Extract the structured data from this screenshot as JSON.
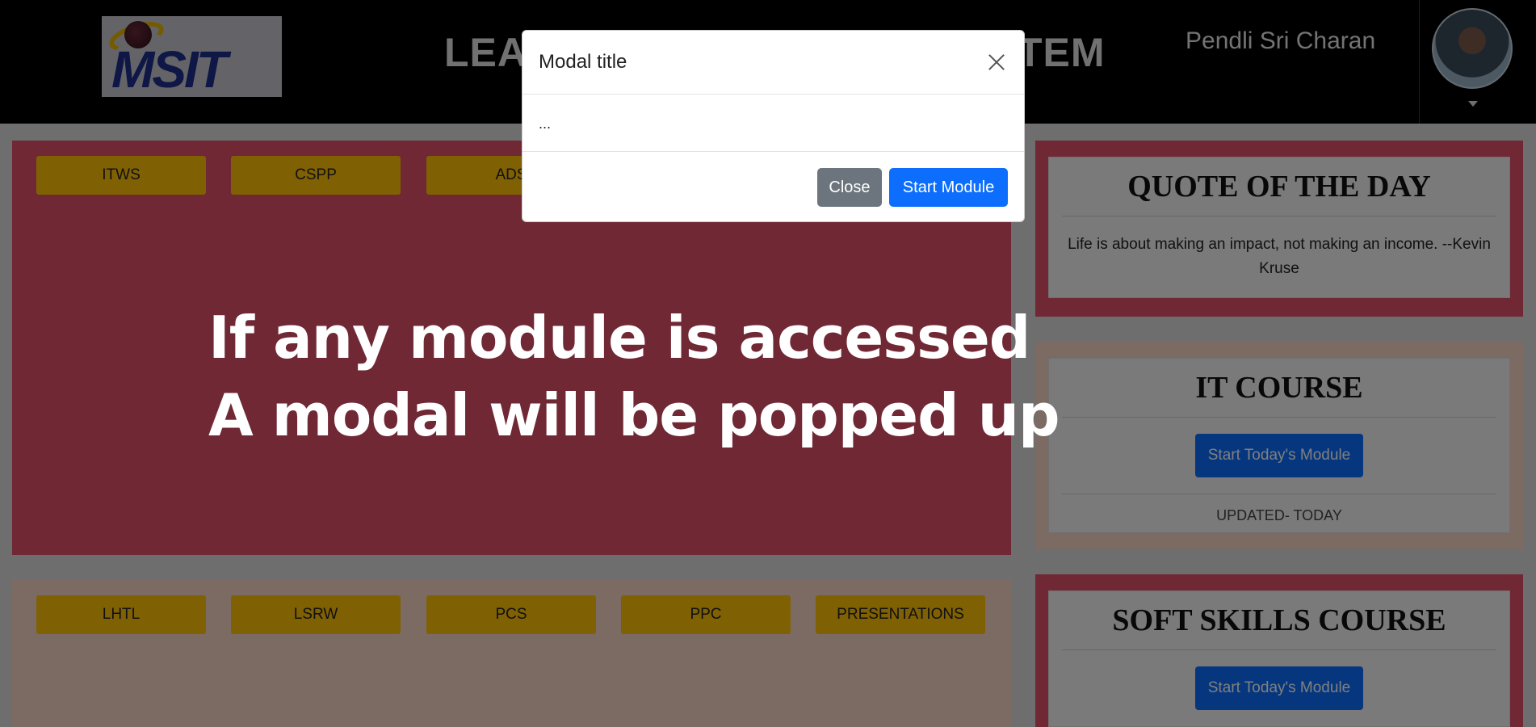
{
  "header": {
    "logo_text": "MSIT",
    "title_left": "LEAR",
    "title_right": "TEM",
    "username": "Pendli Sri Charan"
  },
  "courses_top": [
    "ITWS",
    "CSPP",
    "ADS"
  ],
  "courses_bottom": [
    "LHTL",
    "LSRW",
    "PCS",
    "PPC",
    "PRESENTATIONS"
  ],
  "overlay": {
    "line1": "If any module is accessed",
    "line2": "A modal will be popped up"
  },
  "quote_card": {
    "title": "QUOTE OF THE DAY",
    "text": "Life is about making an impact, not making an income. --Kevin Kruse"
  },
  "it_card": {
    "title": "IT COURSE",
    "button": "Start Today's Module",
    "footer": "UPDATED- TODAY"
  },
  "soft_card": {
    "title": "SOFT SKILLS COURSE",
    "button": "Start Today's Module"
  },
  "modal": {
    "title": "Modal title",
    "body": "...",
    "close_label": "Close",
    "start_label": "Start Module"
  },
  "colors": {
    "header_bg": "#000000",
    "panel_red": "#e0516a",
    "panel_peach": "#f7d6c6",
    "pill_yellow": "#ffc107",
    "primary_blue": "#0d6efd",
    "secondary_gray": "#6c757d"
  }
}
